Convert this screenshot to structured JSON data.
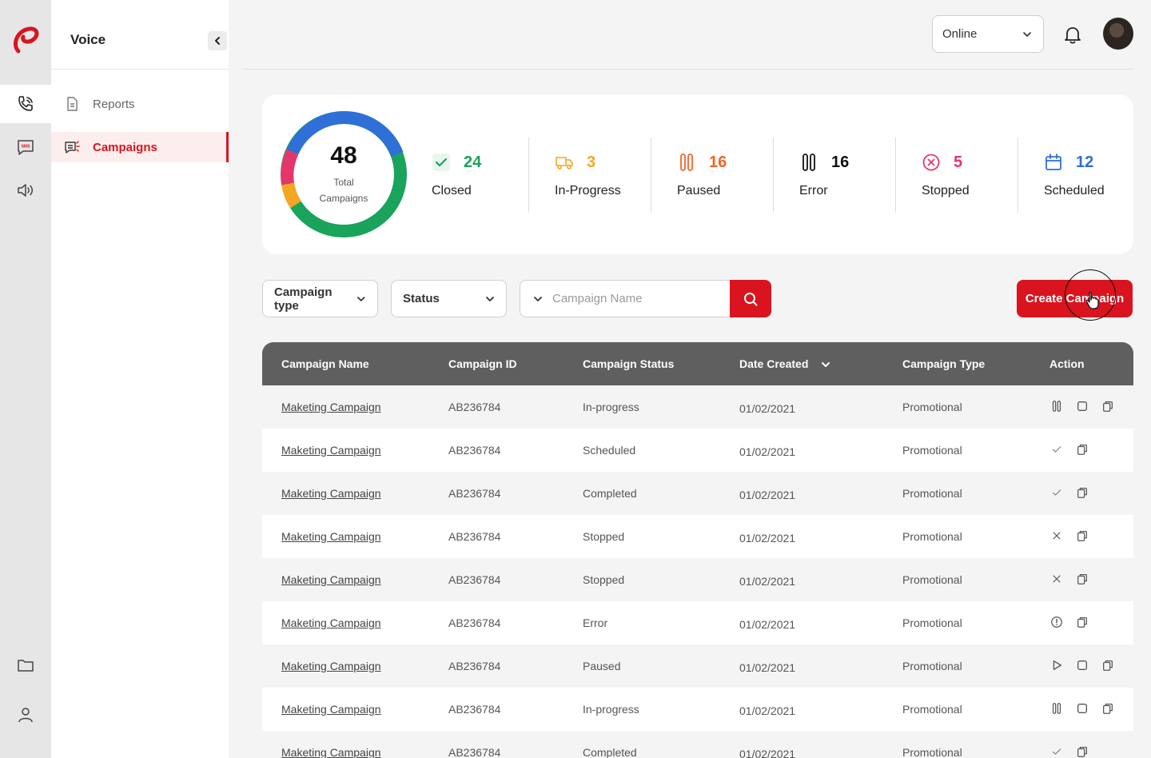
{
  "sidebar": {
    "title": "Voice",
    "items": [
      {
        "label": "Reports",
        "icon": "document-icon"
      },
      {
        "label": "Campaigns",
        "icon": "campaign-list-icon"
      }
    ]
  },
  "topbar": {
    "status_value": "Online"
  },
  "summary": {
    "total": "48",
    "total_label_line1": "Total",
    "total_label_line2": "Campaigns",
    "stats": [
      {
        "label": "Closed",
        "count": "24",
        "color": "#1aa35a"
      },
      {
        "label": "In-Progress",
        "count": "3",
        "color": "#f5a623"
      },
      {
        "label": "Paused",
        "count": "16",
        "color": "#f0642b"
      },
      {
        "label": "Error",
        "count": "16",
        "color": "#111111"
      },
      {
        "label": "Stopped",
        "count": "5",
        "color": "#e5366b"
      },
      {
        "label": "Scheduled",
        "count": "12",
        "color": "#2f6fd8"
      }
    ]
  },
  "filters": {
    "campaign_type": "Campaign type",
    "status": "Status",
    "search_placeholder": "Campaign Name",
    "create_label": "Create Campaign"
  },
  "table": {
    "columns": [
      "Campaign Name",
      "Campaign ID",
      "Campaign Status",
      "Date Created",
      "Campaign Type",
      "Action"
    ],
    "rows": [
      {
        "name": "Maketing Campaign",
        "id": "AB236784",
        "status": "In-progress",
        "date": "01/02/2021",
        "type": "Promotional",
        "actions": [
          "pause-icon",
          "stop-icon",
          "copy-icon"
        ]
      },
      {
        "name": "Maketing Campaign",
        "id": "AB236784",
        "status": "Scheduled",
        "date": "01/02/2021",
        "type": "Promotional",
        "actions": [
          "check-icon",
          "copy-icon"
        ]
      },
      {
        "name": "Maketing Campaign",
        "id": "AB236784",
        "status": "Completed",
        "date": "01/02/2021",
        "type": "Promotional",
        "actions": [
          "check-icon",
          "copy-icon"
        ]
      },
      {
        "name": "Maketing Campaign",
        "id": "AB236784",
        "status": "Stopped",
        "date": "01/02/2021",
        "type": "Promotional",
        "actions": [
          "close-icon",
          "copy-icon"
        ]
      },
      {
        "name": "Maketing Campaign",
        "id": "AB236784",
        "status": "Stopped",
        "date": "01/02/2021",
        "type": "Promotional",
        "actions": [
          "close-icon",
          "copy-icon"
        ]
      },
      {
        "name": "Maketing Campaign",
        "id": "AB236784",
        "status": "Error",
        "date": "01/02/2021",
        "type": "Promotional",
        "actions": [
          "alert-icon",
          "copy-icon"
        ]
      },
      {
        "name": "Maketing Campaign",
        "id": "AB236784",
        "status": "Paused",
        "date": "01/02/2021",
        "type": "Promotional",
        "actions": [
          "play-icon",
          "stop-icon",
          "copy-icon"
        ]
      },
      {
        "name": "Maketing Campaign",
        "id": "AB236784",
        "status": "In-progress",
        "date": "01/02/2021",
        "type": "Promotional",
        "actions": [
          "pause-icon",
          "stop-icon",
          "copy-icon"
        ]
      },
      {
        "name": "Maketing Campaign",
        "id": "AB236784",
        "status": "Completed",
        "date": "01/02/2021",
        "type": "Promotional",
        "actions": [
          "check-icon",
          "copy-icon"
        ]
      }
    ]
  }
}
